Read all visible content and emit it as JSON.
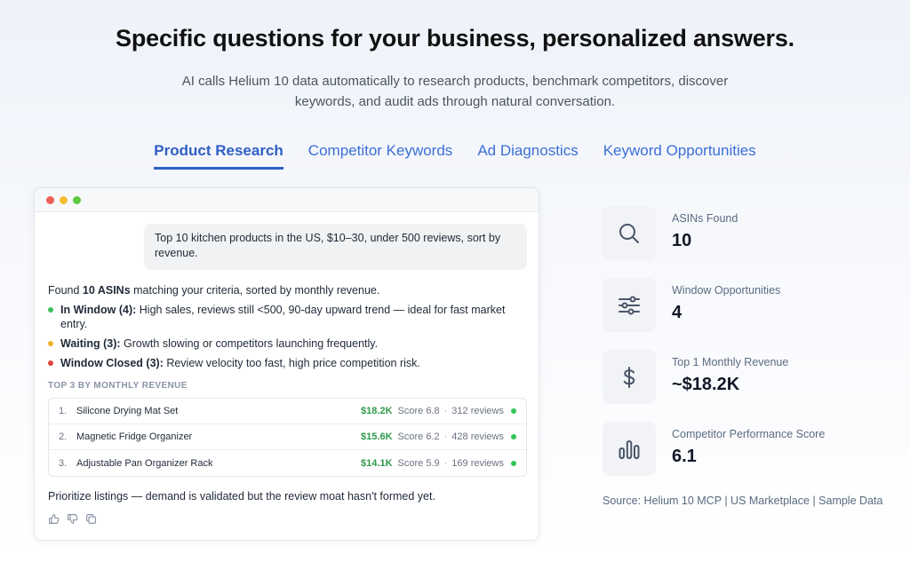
{
  "header": {
    "title": "Specific questions for your business, personalized answers.",
    "subtitle": "AI calls Helium 10 data automatically to research products, benchmark competitors, discover keywords, and audit ads through natural conversation."
  },
  "tabs": [
    {
      "label": "Product Research",
      "active": true
    },
    {
      "label": "Competitor Keywords",
      "active": false
    },
    {
      "label": "Ad Diagnostics",
      "active": false
    },
    {
      "label": "Keyword Opportunities",
      "active": false
    }
  ],
  "chat": {
    "window_dots": [
      "#ec5f57",
      "#f5bd2f",
      "#5ec940"
    ],
    "user_message": "Top 10 kitchen products in the US, $10–30, under 500 reviews, sort by revenue.",
    "reply": {
      "intro_pre": "Found ",
      "intro_bold": "10 ASINs",
      "intro_post": " matching your criteria, sorted by monthly revenue.",
      "bullets": [
        {
          "color": "#3fbf5a",
          "label": "In Window (4):",
          "text": " High sales, reviews still <500, 90-day upward trend — ideal for fast market entry."
        },
        {
          "color": "#f0b429",
          "label": "Waiting (3):",
          "text": " Growth slowing or competitors launching frequently."
        },
        {
          "color": "#e0453a",
          "label": "Window Closed (3):",
          "text": " Review velocity too fast, high price competition risk."
        }
      ],
      "section_label": "TOP 3 BY MONTHLY REVENUE",
      "top3": [
        {
          "rank": "1.",
          "name": "Silicone Drying Mat Set",
          "revenue": "$18.2K",
          "score": "Score 6.8",
          "sep": "·",
          "reviews": "312 reviews"
        },
        {
          "rank": "2.",
          "name": "Magnetic Fridge Organizer",
          "revenue": "$15.6K",
          "score": "Score 6.2",
          "sep": "·",
          "reviews": "428 reviews"
        },
        {
          "rank": "3.",
          "name": "Adjustable Pan Organizer Rack",
          "revenue": "$14.1K",
          "score": "Score 5.9",
          "sep": "·",
          "reviews": "169 reviews"
        }
      ],
      "conclusion": "Prioritize listings — demand is validated but the review moat hasn't formed yet."
    },
    "actions": [
      "thumbs-up-icon",
      "thumbs-down-icon",
      "copy-icon"
    ]
  },
  "stats": [
    {
      "icon": "search-icon",
      "label": "ASINs Found",
      "value": "10"
    },
    {
      "icon": "sliders-icon",
      "label": "Window Opportunities",
      "value": "4"
    },
    {
      "icon": "dollar-icon",
      "label": "Top 1 Monthly Revenue",
      "value": "~$18.2K"
    },
    {
      "icon": "bar-chart-icon",
      "label": "Competitor Performance Score",
      "value": "6.1"
    }
  ],
  "source": "Source: Helium 10 MCP | US Marketplace | Sample Data"
}
